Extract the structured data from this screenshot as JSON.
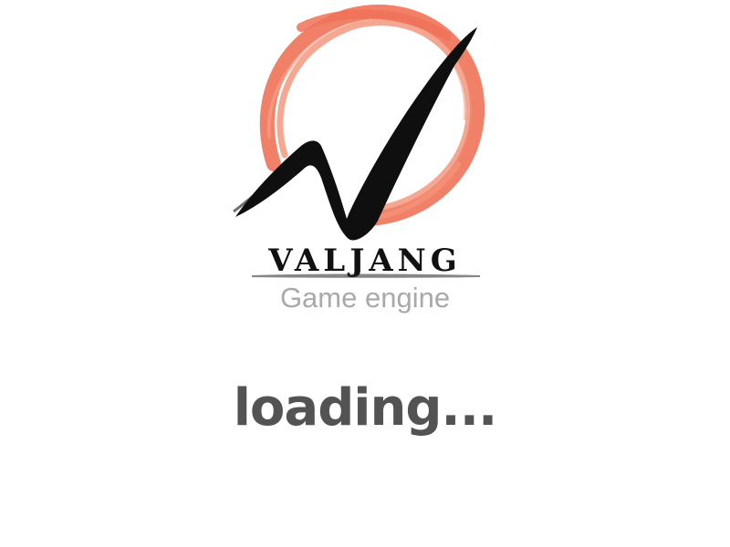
{
  "splash": {
    "brand": "VALJANG",
    "tagline": "Game engine",
    "status": "loading..."
  },
  "colors": {
    "background": "#ffffff",
    "ring": "#ee7258",
    "mark": "#0f0f0f",
    "tagline": "#a9a9a9",
    "status": "#535353"
  },
  "icons": {
    "logo": "valjang-logo-icon"
  }
}
